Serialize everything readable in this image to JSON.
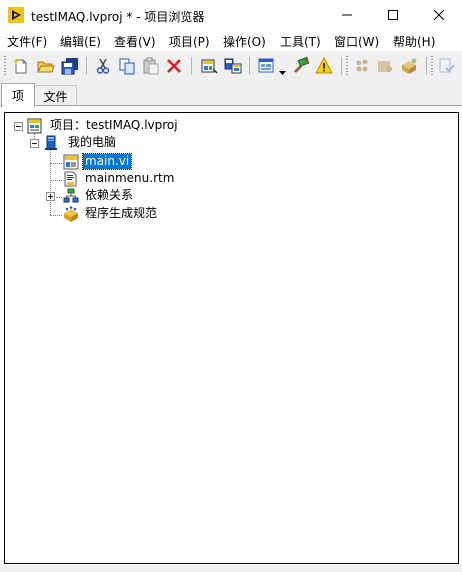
{
  "window": {
    "title": "testIMAQ.lvproj * - 项目浏览器",
    "controls": [
      "minimize-icon",
      "maximize-icon",
      "close-icon"
    ]
  },
  "menu": {
    "file": "文件(F)",
    "edit": "编辑(E)",
    "view": "查看(V)",
    "project": "项目(P)",
    "operate": "操作(O)",
    "tools": "工具(T)",
    "window": "窗口(W)",
    "help": "帮助(H)"
  },
  "toolbar": {
    "icons": [
      "new-icon",
      "open-icon",
      "save-all-icon",
      "cut-icon",
      "copy-icon",
      "paste-icon",
      "delete-icon",
      "project-settings-icon",
      "save-project-icon",
      "view-dropdown-icon",
      "build-icon",
      "warning-icon",
      "add-file-icon",
      "add-folder-icon",
      "build-spec-icon",
      "source-control-icon"
    ]
  },
  "tabs": {
    "items": "项",
    "files": "文件"
  },
  "tree": {
    "project": "项目：testIMAQ.lvproj",
    "my_computer": "我的电脑",
    "main_vi": "main.vi",
    "mainmenu": "mainmenu.rtm",
    "dependencies": "依赖关系",
    "build_specs": "程序生成规范",
    "selected": "main.vi"
  },
  "colors": {
    "selection": "#0078d7",
    "labview_yellow": "#f0c419",
    "delete_red": "#e02020"
  }
}
